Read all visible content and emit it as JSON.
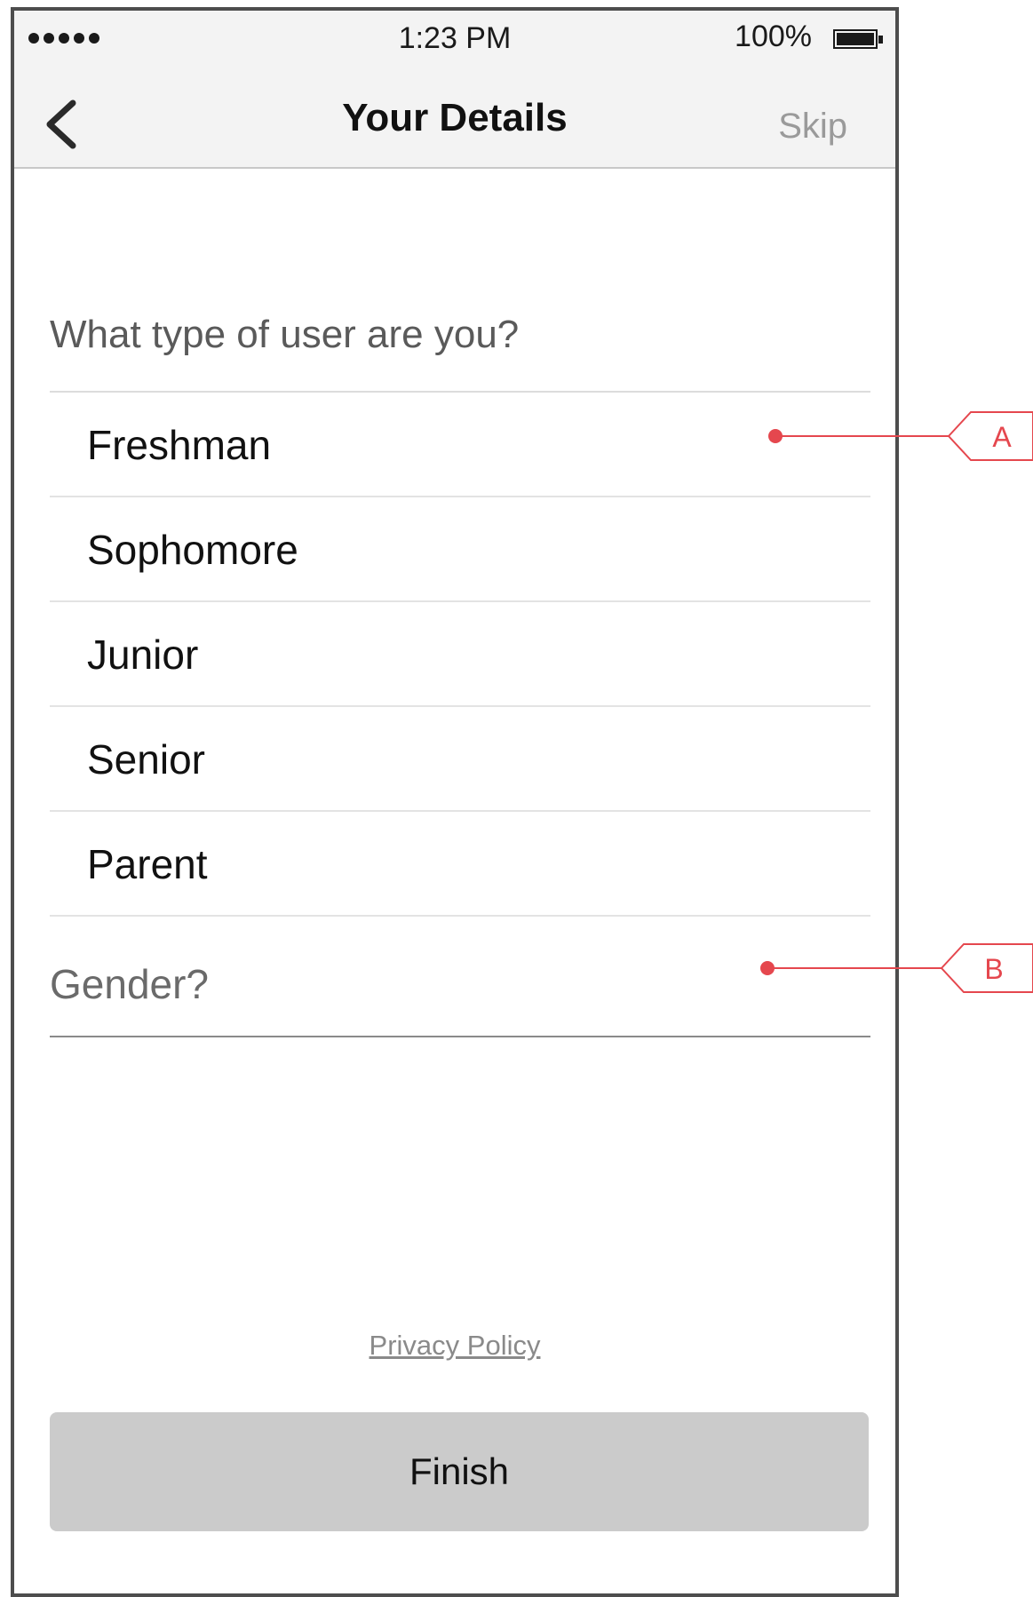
{
  "status_bar": {
    "time": "1:23 PM",
    "battery": "100%",
    "signal_dots": 5
  },
  "nav": {
    "title": "Your Details",
    "skip_label": "Skip",
    "back_icon": "chevron-left-icon"
  },
  "form": {
    "question": "What type of user are you?",
    "options": [
      "Freshman",
      "Sophomore",
      "Junior",
      "Senior",
      "Parent"
    ],
    "gender_placeholder": "Gender?"
  },
  "footer": {
    "privacy_label": "Privacy Policy",
    "finish_label": "Finish"
  },
  "annotations": {
    "a_label": "A",
    "b_label": "B",
    "color": "#e5474e"
  },
  "colors": {
    "bar_background": "#f3f3f3",
    "button_background": "#cbcbcb",
    "muted_text": "#9a9a9a"
  }
}
